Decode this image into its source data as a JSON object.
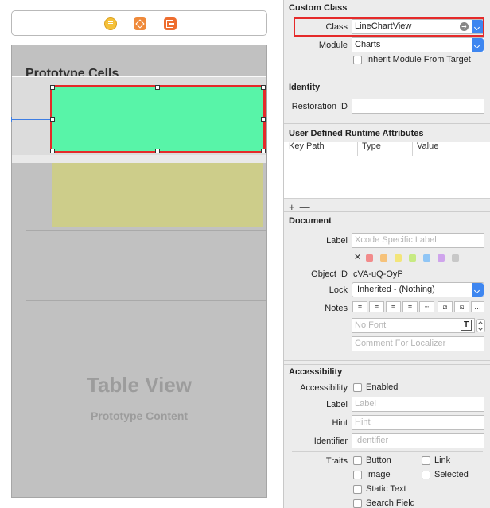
{
  "canvas": {
    "section_title": "Prototype Cells",
    "table_view_title": "Table View",
    "table_view_subtitle": "Prototype Content"
  },
  "custom_class": {
    "header": "Custom Class",
    "class_label": "Class",
    "class_value": "LineChartView",
    "module_label": "Module",
    "module_value": "Charts",
    "inherit_label": "Inherit Module From Target"
  },
  "identity": {
    "header": "Identity",
    "restoration_label": "Restoration ID",
    "restoration_value": ""
  },
  "runtime_attributes": {
    "header": "User Defined Runtime Attributes",
    "columns": [
      "Key Path",
      "Type",
      "Value"
    ],
    "add_symbol": "+",
    "remove_symbol": "—"
  },
  "document": {
    "header": "Document",
    "label_label": "Label",
    "label_placeholder": "Xcode Specific Label",
    "clear_symbol": "✕",
    "label_colors": [
      "#f28b8b",
      "#f6c27a",
      "#f3e57a",
      "#c7ea82",
      "#8fc5f5",
      "#cfa4ec",
      "#c8c8c8"
    ],
    "object_id_label": "Object ID",
    "object_id_value": "cVA-uQ-OyP",
    "lock_label": "Lock",
    "lock_value": "Inherited - (Nothing)",
    "notes_label": "Notes",
    "notes_more": "…",
    "font_placeholder": "No Font",
    "font_glyph": "T",
    "comment_placeholder": "Comment For Localizer"
  },
  "accessibility": {
    "header": "Accessibility",
    "accessibility_label": "Accessibility",
    "enabled_label": "Enabled",
    "label_label": "Label",
    "label_placeholder": "Label",
    "hint_label": "Hint",
    "hint_placeholder": "Hint",
    "identifier_label": "Identifier",
    "identifier_placeholder": "Identifier",
    "traits_label": "Traits",
    "traits": [
      "Button",
      "Link",
      "Image",
      "Selected",
      "Static Text",
      "Search Field"
    ]
  }
}
